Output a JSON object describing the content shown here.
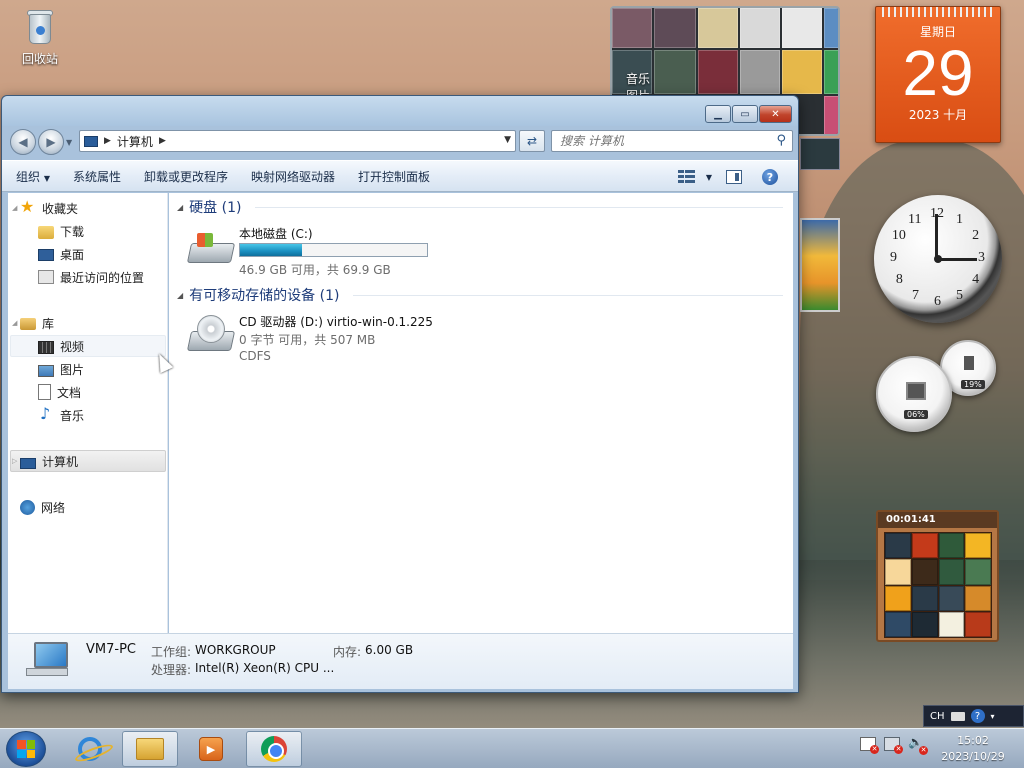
{
  "desktop": {
    "recycle_bin_label": "回收站"
  },
  "gadgets": {
    "slideshow_label": "音乐\n图片",
    "calendar": {
      "weekday": "星期日",
      "day": "29",
      "month": "2023 十月"
    },
    "clock_numbers": [
      "12",
      "1",
      "2",
      "3",
      "4",
      "5",
      "6",
      "7",
      "8",
      "9",
      "10",
      "11"
    ],
    "clock_time": "15:02",
    "cpu_meter": {
      "cpu_percent": "06%",
      "memory_percent": "19%"
    },
    "puzzle_timer": "00:01:41"
  },
  "window": {
    "address": {
      "root_label": "计算机"
    },
    "search": {
      "placeholder": "搜索 计算机"
    },
    "toolbar": {
      "organize": "组织",
      "system_properties": "系统属性",
      "uninstall": "卸载或更改程序",
      "map_drive": "映射网络驱动器",
      "control_panel": "打开控制面板"
    },
    "navpane": {
      "favorites": "收藏夹",
      "favorites_items": [
        "下载",
        "桌面",
        "最近访问的位置"
      ],
      "libraries": "库",
      "library_items": [
        "视频",
        "图片",
        "文档",
        "音乐"
      ],
      "computer": "计算机",
      "network": "网络"
    },
    "content": {
      "hdd_group": "硬盘 (1)",
      "removable_group": "有可移动存储的设备 (1)",
      "drive_c": {
        "name": "本地磁盘 (C:)",
        "space": "46.9 GB 可用，共 69.9 GB",
        "used_fraction": 0.33
      },
      "drive_d": {
        "name": "CD 驱动器 (D:) virtio-win-0.1.225",
        "space": "0 字节 可用，共 507 MB",
        "fs": "CDFS"
      }
    },
    "details": {
      "pc_name": "VM7-PC",
      "workgroup_label": "工作组:",
      "workgroup": "WORKGROUP",
      "memory_label": "内存:",
      "memory": "6.00 GB",
      "processor_label": "处理器:",
      "processor": "Intel(R) Xeon(R) CPU ..."
    }
  },
  "langbar": {
    "lang": "CH"
  },
  "taskbar": {
    "time": "15:02",
    "date": "2023/10/29"
  },
  "colors": {
    "accent": "#1e3c7a",
    "calendar": "#e85a1c",
    "drive_bar": "#1a8fc0"
  }
}
